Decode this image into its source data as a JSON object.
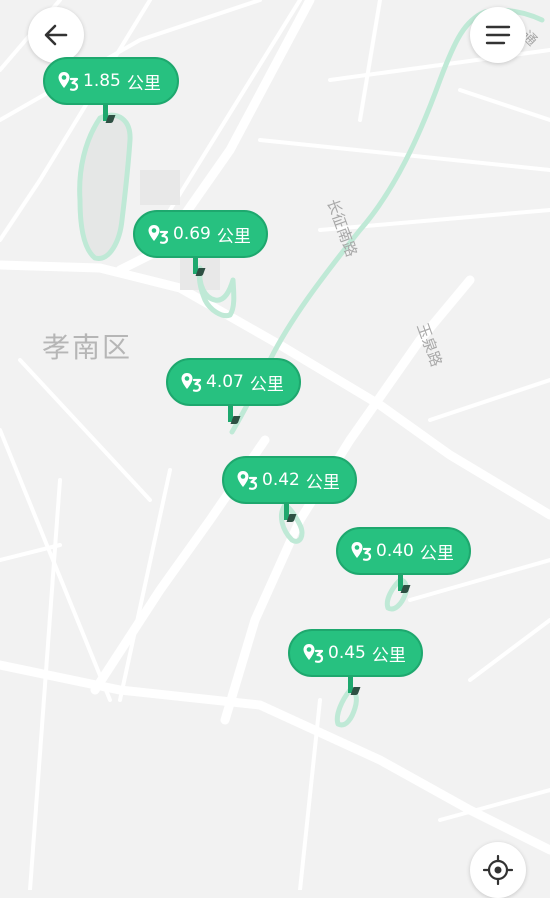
{
  "map": {
    "district_label": "孝南区",
    "road_labels": [
      {
        "text": "长征南路"
      },
      {
        "text": "玉泉路"
      },
      {
        "text": "通"
      }
    ]
  },
  "controls": {
    "back": "arrow-left-icon",
    "menu": "menu-icon",
    "locate": "locate-icon"
  },
  "markers": [
    {
      "distance": "1.85",
      "unit": "公里"
    },
    {
      "distance": "0.69",
      "unit": "公里"
    },
    {
      "distance": "4.07",
      "unit": "公里"
    },
    {
      "distance": "0.42",
      "unit": "公里"
    },
    {
      "distance": "0.40",
      "unit": "公里"
    },
    {
      "distance": "0.45",
      "unit": "公里"
    }
  ],
  "colors": {
    "marker_fill": "#27c180",
    "route_line": "#bfe9d6",
    "road": "#ffffff",
    "map_bg": "#f2f2f2"
  }
}
